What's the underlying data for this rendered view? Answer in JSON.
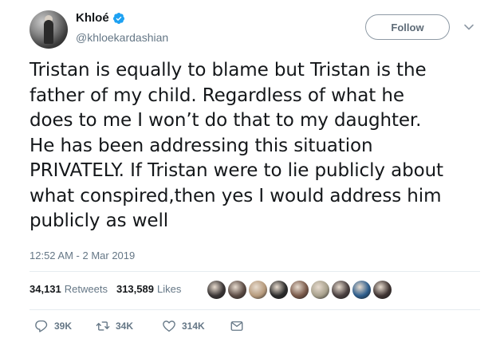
{
  "author": {
    "name": "Khloé",
    "handle": "@khloekardashian",
    "verified": true
  },
  "follow_button": {
    "label": "Follow"
  },
  "tweet": {
    "text": "Tristan is equally to blame but Tristan is the\nfather of my child. Regardless of what he\ndoes to me I won’t do that to my daughter.\nHe has been addressing this situation\nPRIVATELY. If Tristan were to lie publicly about\nwhat conspired,then yes I would address him\npublicly as well",
    "timestamp": "12:52 AM - 2 Mar 2019"
  },
  "stats": {
    "retweets": {
      "count": "34,131",
      "label": "Retweets"
    },
    "likes": {
      "count": "313,589",
      "label": "Likes"
    }
  },
  "likers": [
    {
      "color": "#3a3535"
    },
    {
      "color": "#5b4b44"
    },
    {
      "color": "#b69a7c"
    },
    {
      "color": "#2b2b2b"
    },
    {
      "color": "#7a5a4a"
    },
    {
      "color": "#a7a08c"
    },
    {
      "color": "#4a4040"
    },
    {
      "color": "#2d5d8c"
    },
    {
      "color": "#3f3432"
    }
  ],
  "actions": {
    "reply": {
      "icon": "reply-icon",
      "count": "39K"
    },
    "retweet": {
      "icon": "retweet-icon",
      "count": "34K"
    },
    "like": {
      "icon": "heart-icon",
      "count": "314K"
    },
    "dm": {
      "icon": "envelope-icon"
    }
  },
  "colors": {
    "verified": "#1da1f2",
    "secondary_text": "#657786",
    "divider": "#e6ecf0"
  }
}
